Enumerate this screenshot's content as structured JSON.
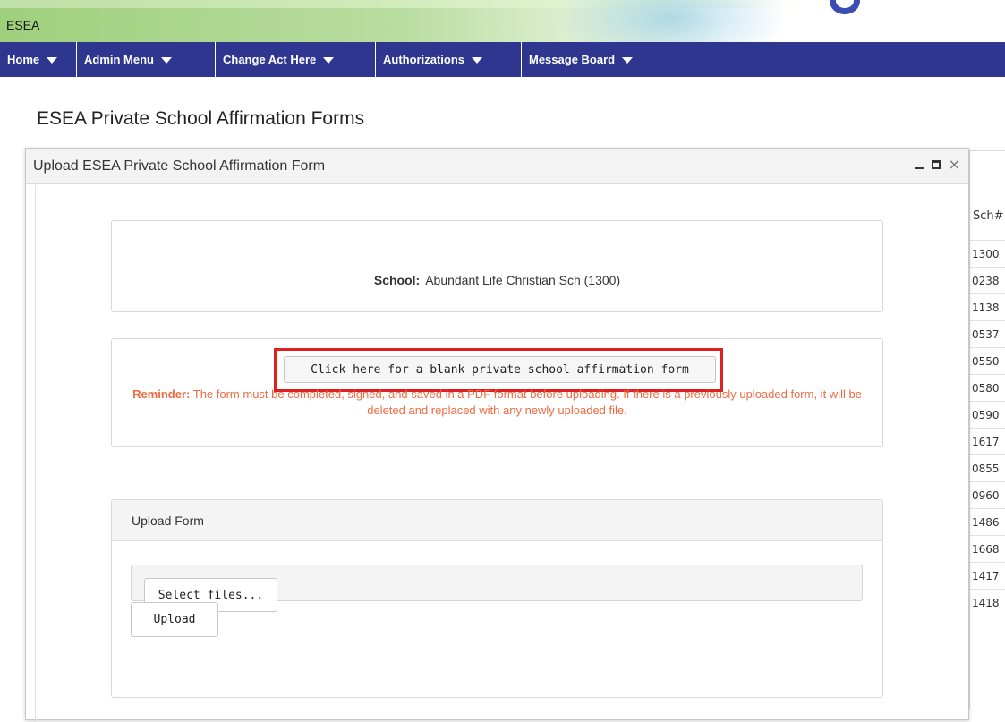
{
  "banner": {
    "app_label": "ESEA"
  },
  "nav": {
    "items": [
      {
        "label": "Home"
      },
      {
        "label": "Admin Menu"
      },
      {
        "label": "Change Act Here"
      },
      {
        "label": "Authorizations"
      },
      {
        "label": "Message Board"
      }
    ]
  },
  "page": {
    "title": "ESEA Private School Affirmation Forms"
  },
  "dialog": {
    "title": "Upload ESEA Private School Affirmation Form",
    "controls": [
      "minimize-icon",
      "maximize-icon",
      "close-icon"
    ],
    "school_label": "School:",
    "school_value": "Abundant Life Christian Sch (1300)",
    "blank_form_button": "Click here for a blank private school affirmation form",
    "reminder_label": "Reminder:",
    "reminder_text": "The form must be completed, signed, and saved in a PDF format before uploading. If there is a previously uploaded form, it will be deleted and replaced with any newly uploaded file.",
    "upload_section_title": "Upload Form",
    "select_files_button": "Select files...",
    "upload_button": "Upload",
    "highlight_color": "#e02020",
    "reminder_color": "#ee6b42"
  },
  "background_table": {
    "header": "Sch#",
    "rows": [
      "1300",
      "0238",
      "1138",
      "0537",
      "0550",
      "0580",
      "0590",
      "1617",
      "0855",
      "0960",
      "1486",
      "1668",
      "1417",
      "1418"
    ]
  },
  "colors": {
    "nav_bg": "#2f3690"
  }
}
